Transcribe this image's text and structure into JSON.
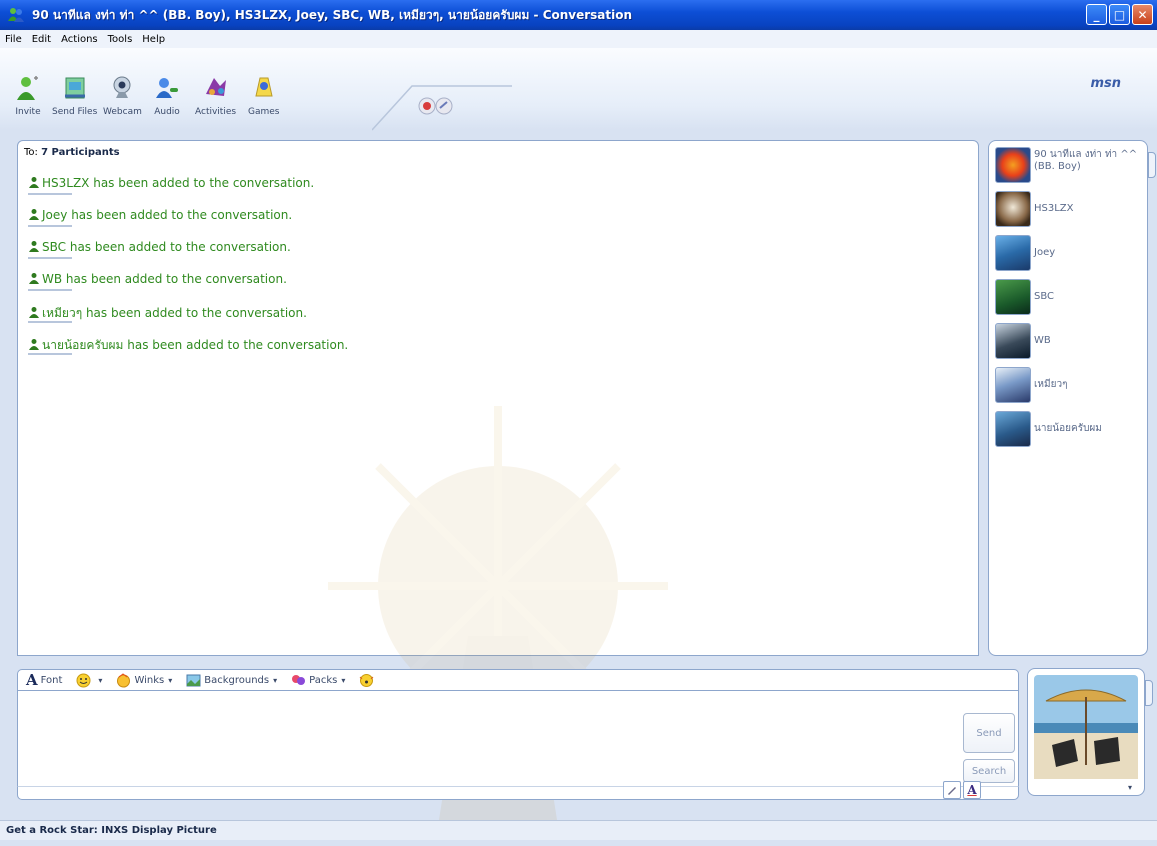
{
  "window": {
    "title": "90 นาทีแล งท่า ท่า ^^ (BB. Boy), HS3LZX, Joey, SBC, WB, เหมียวๆ, นายน้อยครับผม - Conversation",
    "minimize": "_",
    "maximize": "□",
    "close": "✕"
  },
  "menu": [
    "File",
    "Edit",
    "Actions",
    "Tools",
    "Help"
  ],
  "toolbar": {
    "buttons": [
      {
        "label": "Invite",
        "icon": "invite-icon"
      },
      {
        "label": "Send Files",
        "icon": "send-files-icon"
      },
      {
        "label": "Webcam",
        "icon": "webcam-icon"
      },
      {
        "label": "Audio",
        "icon": "audio-icon"
      },
      {
        "label": "Activities",
        "icon": "activities-icon"
      },
      {
        "label": "Games",
        "icon": "games-icon"
      }
    ],
    "brand": "msn"
  },
  "conversation": {
    "to_prefix": "To:",
    "to_value": "7 Participants",
    "messages": [
      {
        "name": "HS3LZX",
        "text": " has been added to the conversation."
      },
      {
        "name": "Joey",
        "text": " has been added to the conversation."
      },
      {
        "name": "SBC",
        "text": " has been added to the conversation."
      },
      {
        "name": "WB",
        "text": " has been added to the conversation."
      },
      {
        "name": "เหมียวๆ",
        "text": " has been added to the conversation."
      },
      {
        "name": "นายน้อยครับผม",
        "text": " has been added to the conversation."
      }
    ]
  },
  "participants": [
    {
      "name": "90 นาทีแล งท่า ท่า ^^ (BB. Boy)",
      "color": "#e8401a"
    },
    {
      "name": "HS3LZX",
      "color": "#6a4a2a"
    },
    {
      "name": "Joey",
      "color": "#2a6aa8"
    },
    {
      "name": "SBC",
      "color": "#2a6a2a"
    },
    {
      "name": "WB",
      "color": "#1a2a3a"
    },
    {
      "name": "เหมียวๆ",
      "color": "#4a6a9a"
    },
    {
      "name": "นายน้อยครับผม",
      "color": "#2a5a8a"
    }
  ],
  "format_bar": {
    "font": "Font",
    "winks": "Winks",
    "backgrounds": "Backgrounds",
    "packs": "Packs"
  },
  "compose": {
    "send": "Send",
    "search": "Search"
  },
  "status": {
    "text": "Get a Rock Star: INXS Display Picture"
  }
}
